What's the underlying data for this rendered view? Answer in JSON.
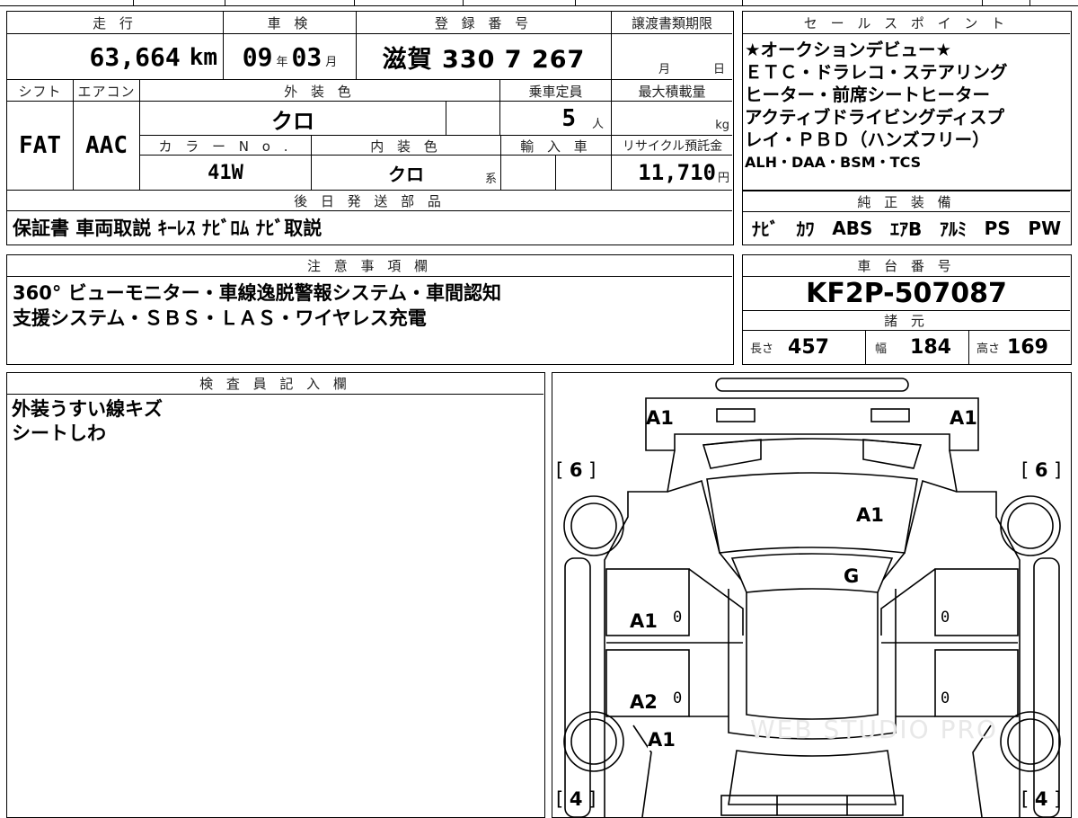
{
  "main": {
    "headers": {
      "mileage": "走 行",
      "inspection": "車 検",
      "registration": "登 録 番 号",
      "transfer_deadline": "譲渡書類期限",
      "shift": "シフト",
      "aircon": "エアコン",
      "exterior_color": "外 装 色",
      "capacity": "乗車定員",
      "max_load": "最大積載量",
      "color_no": "カ ラ ー N o .",
      "interior_color": "内 装 色",
      "import": "輸 入 車",
      "recycle": "リサイクル預託金",
      "later_parts": "後 日 発 送 部 品"
    },
    "mileage": "63,664",
    "mileage_unit": "km",
    "inspection_year": "09",
    "inspection_year_unit": "年",
    "inspection_month": "03",
    "inspection_month_unit": "月",
    "registration": "滋賀 330 7 267",
    "deadline_month_unit": "月",
    "deadline_day_unit": "日",
    "shift": "FAT",
    "aircon": "AAC",
    "exterior_color": "クロ",
    "capacity": "5",
    "capacity_unit": "人",
    "max_load_unit": "kg",
    "color_no": "41W",
    "interior_color": "クロ",
    "interior_suffix": "系",
    "recycle_fee": "11,710",
    "recycle_unit": "円",
    "later_parts": "保証書 車両取説 ｷｰﾚｽ ﾅﾋﾞﾛﾑ ﾅﾋﾞ取説"
  },
  "sales": {
    "header": "セ ー ル ス ポ イ ン ト",
    "lines": [
      "★オークションデビュー★",
      "ＥＴＣ・ドラレコ・ステアリング",
      "ヒーター・前席シートヒーター",
      "アクティブドライビングディスプ",
      "レイ・ＰＢＤ（ハンズフリー）",
      "ALH・DAA・BSM・TCS"
    ]
  },
  "equipment": {
    "header": "純 正 装 備",
    "items": [
      "ﾅﾋﾞ",
      "ｶﾜ",
      "ABS",
      "ｴｱB",
      "ｱﾙﾐ",
      "PS",
      "PW"
    ]
  },
  "notes": {
    "header": "注 意 事 項 欄",
    "lines": [
      "360° ビューモニター・車線逸脱警報システム・車間認知",
      "支援システム・ＳＢＳ・ＬＡＳ・ワイヤレス充電"
    ]
  },
  "chassis": {
    "header": "車 台 番 号",
    "number": "KF2P-507087"
  },
  "specs": {
    "header": "諸 元",
    "length_label": "長さ",
    "length": "457",
    "width_label": "幅",
    "width": "184",
    "height_label": "高さ",
    "height": "169"
  },
  "inspector": {
    "header": "検 査 員 記 入 欄",
    "lines": [
      "外装うすい線キズ",
      "シートしわ"
    ]
  },
  "diagram": {
    "marks": {
      "front_left": "A1",
      "front_right": "A1",
      "hood": "A1",
      "windshield": "G",
      "front_door_left": "A1",
      "rear_door_left": "A2",
      "rear_fender_left": "A1",
      "door_zero_1": "0",
      "door_zero_2": "0",
      "door_zero_3": "0",
      "door_zero_4": "0"
    },
    "tires": {
      "front_left": "6",
      "front_right": "6",
      "rear_left": "4",
      "rear_right": "4"
    },
    "watermark": "WEB STUDIO PRO"
  }
}
